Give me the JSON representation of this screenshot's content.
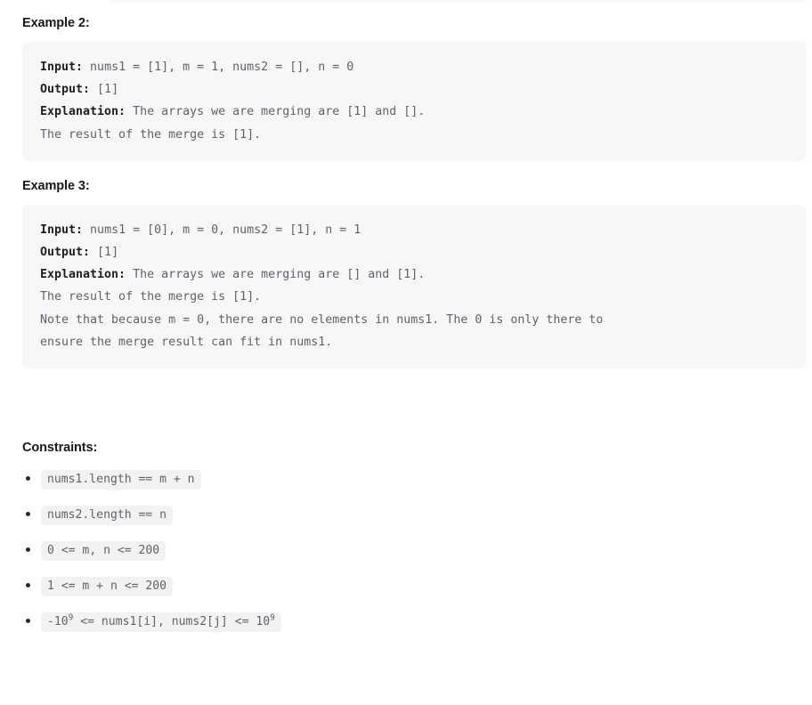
{
  "sections": [
    {
      "heading": "Example 2:",
      "code_lines": [
        {
          "label": "Input:",
          "text": " nums1 = [1], m = 1, nums2 = [], n = 0"
        },
        {
          "label": "Output:",
          "text": " [1]"
        },
        {
          "label": "Explanation:",
          "text": " The arrays we are merging are [1] and []."
        },
        {
          "label": "",
          "text": "The result of the merge is [1]."
        }
      ]
    },
    {
      "heading": "Example 3:",
      "code_lines": [
        {
          "label": "Input:",
          "text": " nums1 = [0], m = 0, nums2 = [1], n = 1"
        },
        {
          "label": "Output:",
          "text": " [1]"
        },
        {
          "label": "Explanation:",
          "text": " The arrays we are merging are [] and [1]."
        },
        {
          "label": "",
          "text": "The result of the merge is [1]."
        },
        {
          "label": "",
          "text": "Note that because m = 0, there are no elements in nums1. The 0 is only there to"
        },
        {
          "label": "",
          "text": "ensure the merge result can fit in nums1."
        }
      ]
    }
  ],
  "constraints": {
    "heading": "Constraints:",
    "items": [
      {
        "prefix": "nums1.length == m + n",
        "sup": "",
        "suffix": ""
      },
      {
        "prefix": "nums2.length == n",
        "sup": "",
        "suffix": ""
      },
      {
        "prefix": "0 <= m, n <= 200",
        "sup": "",
        "suffix": ""
      },
      {
        "prefix": "1 <= m + n <= 200",
        "sup": "",
        "suffix": ""
      },
      {
        "prefix": "-10",
        "sup": "9",
        "suffix": " <= nums1[i], nums2[j] <= 10"
      }
    ],
    "last_item_trailing_sup": "9"
  },
  "colors": {
    "page_background": "#ffffff",
    "code_block_background": "#f7f7f8",
    "inline_code_background": "#f2f2f3",
    "code_text": "#5f6368",
    "heading_text": "#1a1a1a",
    "label_text": "#1f1f1f"
  }
}
